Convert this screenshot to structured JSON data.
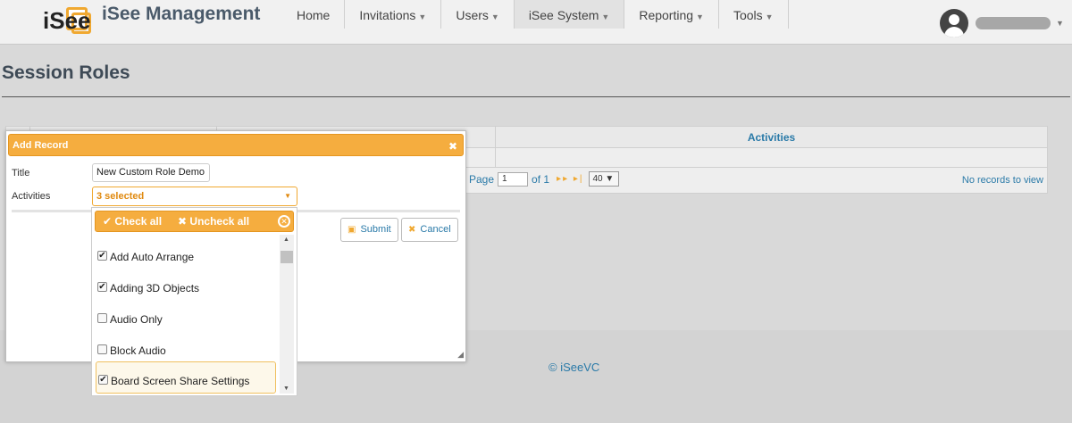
{
  "app": {
    "logo_text": "iSee",
    "title": "iSee Management"
  },
  "nav": {
    "items": [
      {
        "label": "Home",
        "caret": ""
      },
      {
        "label": "Invitations",
        "caret": "▼"
      },
      {
        "label": "Users",
        "caret": "▼"
      },
      {
        "label": "iSee System",
        "caret": "▼"
      },
      {
        "label": "Reporting",
        "caret": "▼"
      },
      {
        "label": "Tools",
        "caret": "▼"
      }
    ]
  },
  "page": {
    "title": "Session Roles"
  },
  "grid": {
    "columns": [
      "Activities"
    ],
    "pager": {
      "page_label": "Page",
      "page_value": "1",
      "of_label": "of 1",
      "rows_value": "40"
    },
    "no_records": "No records to view"
  },
  "dialog": {
    "title": "Add Record",
    "title_label": "Title",
    "title_value": "New Custom Role Demo",
    "activities_label": "Activities",
    "activities_value": "3 selected",
    "submit_label": "Submit",
    "cancel_label": "Cancel"
  },
  "multiselect": {
    "check_all": "Check all",
    "uncheck_all": "Uncheck all",
    "options": [
      {
        "label": "Add Auto Arrange",
        "checked": true
      },
      {
        "label": "Adding 3D Objects",
        "checked": true
      },
      {
        "label": "Audio Only",
        "checked": false
      },
      {
        "label": "Block Audio",
        "checked": false
      },
      {
        "label": "Board Screen Share Settings",
        "checked": true
      }
    ]
  },
  "footer": {
    "text": "© iSeeVC"
  },
  "colors": {
    "accent": "#f5ad3f",
    "link": "#2a7aa8"
  }
}
